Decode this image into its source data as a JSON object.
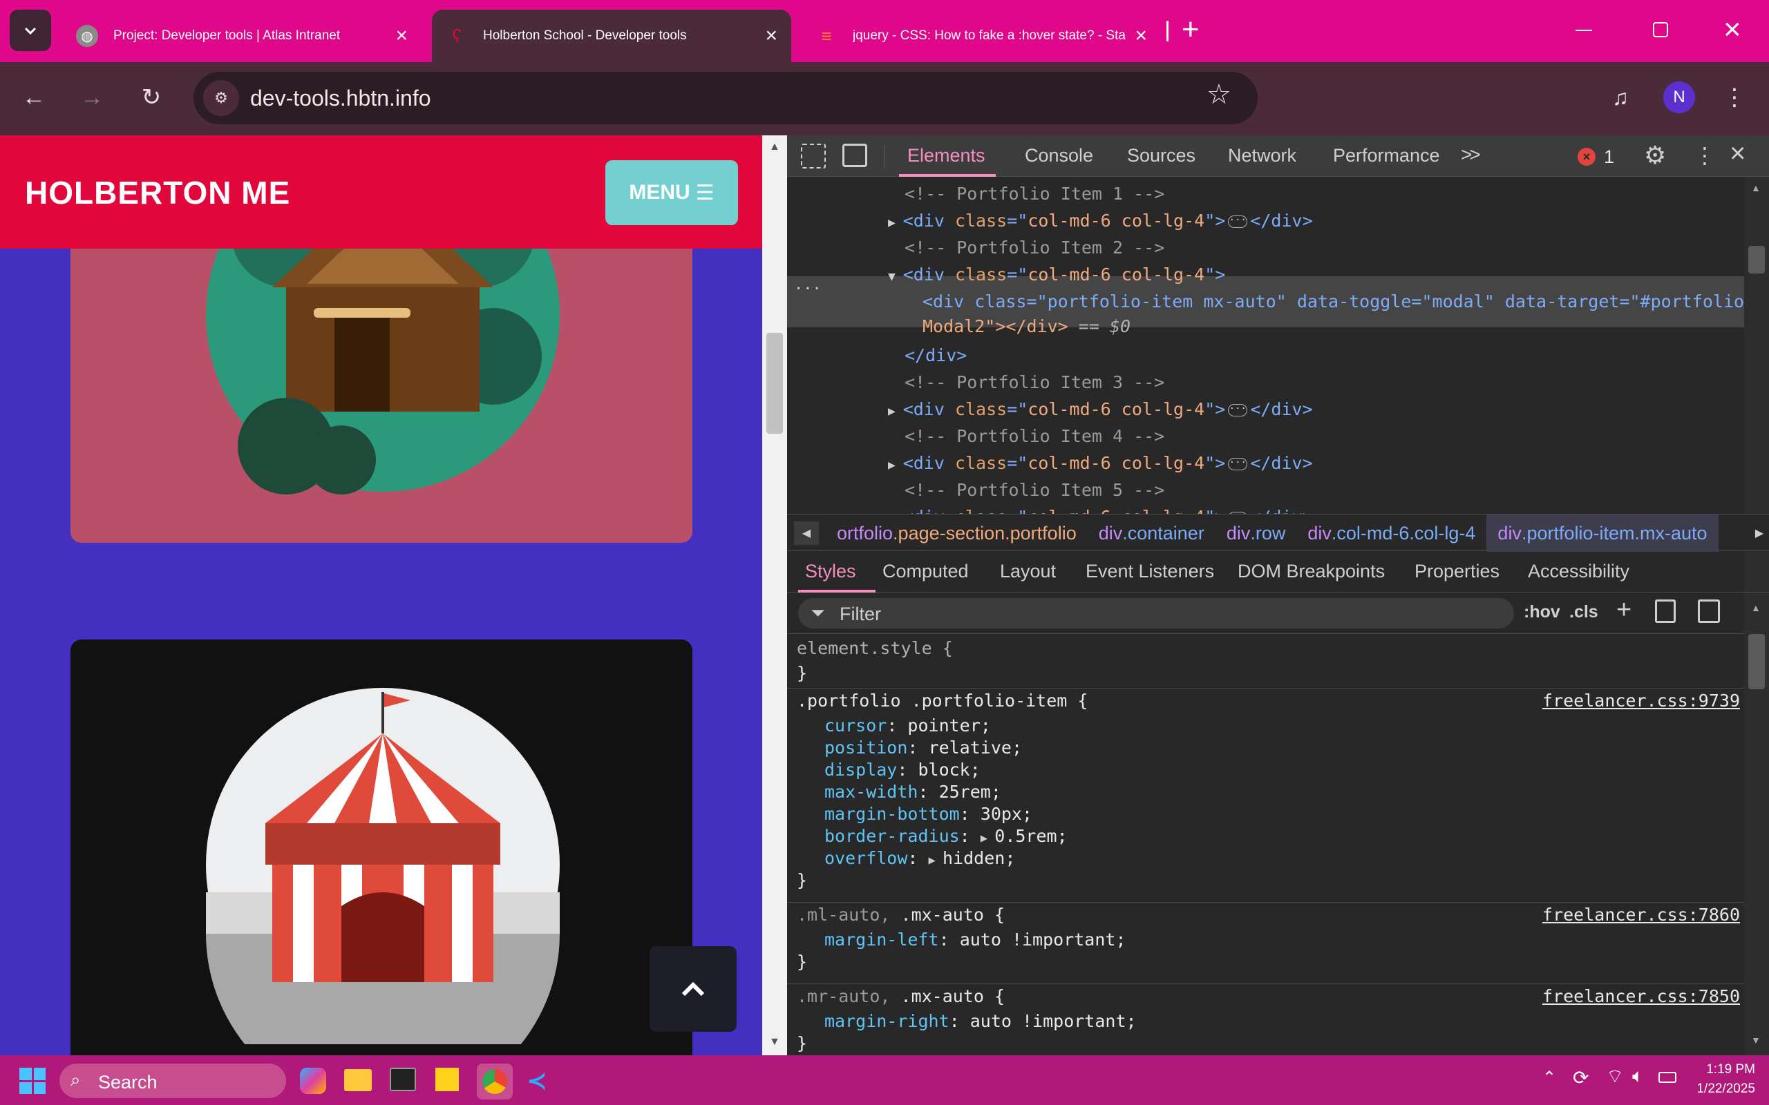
{
  "browser": {
    "tabs": [
      {
        "title": "Project: Developer tools | Atlas Intranet",
        "favicon": "globe-icon"
      },
      {
        "title": "Holberton School - Developer tools",
        "favicon": "seahorse-icon"
      },
      {
        "title": "jquery - CSS: How to fake a :hover state? - Stack",
        "favicon": "stackoverflow-icon"
      }
    ],
    "new_tab": "+",
    "url": "dev-tools.hbtn.info",
    "profile_initial": "N"
  },
  "site": {
    "brand": "HOLBERTON ME",
    "menu_label": "MENU",
    "back_to_top": "^"
  },
  "devtools": {
    "tabs": [
      "Elements",
      "Console",
      "Sources",
      "Network",
      "Performance"
    ],
    "more": ">>",
    "error_count": "1",
    "dom_lines": [
      {
        "type": "comment",
        "text": "<!-- Portfolio Item 1 -->"
      },
      {
        "type": "collapsed",
        "tag": "div",
        "attr": "class",
        "value": "col-md-6 col-lg-4"
      },
      {
        "type": "comment",
        "text": "<!-- Portfolio Item 2 -->"
      },
      {
        "type": "open",
        "tag": "div",
        "attr": "class",
        "value": "col-md-6 col-lg-4"
      },
      {
        "type": "selected",
        "line1": "<div class=\"portfolio-item mx-auto\" data-toggle=\"modal\" data-target=\"#portfolio",
        "line2": "Modal2\"></div>",
        "dollar": "== $0"
      },
      {
        "type": "close",
        "text": "</div>"
      },
      {
        "type": "comment",
        "text": "<!-- Portfolio Item 3 -->"
      },
      {
        "type": "collapsed",
        "tag": "div",
        "attr": "class",
        "value": "col-md-6 col-lg-4"
      },
      {
        "type": "comment",
        "text": "<!-- Portfolio Item 4 -->"
      },
      {
        "type": "collapsed",
        "tag": "div",
        "attr": "class",
        "value": "col-md-6 col-lg-4"
      },
      {
        "type": "comment",
        "text": "<!-- Portfolio Item 5 -->"
      },
      {
        "type": "collapsed",
        "tag": "div",
        "attr": "class",
        "value": "col-md-6 col-lg-4"
      }
    ],
    "breadcrumbs": [
      {
        "text": "ortfolio.page-section.portfolio",
        "prefix": "",
        "tagPart": "ortfolio",
        "classPart": ".page-section.portfolio"
      },
      {
        "text": "div.container",
        "tagPart": "div",
        "classPart": ".container"
      },
      {
        "text": "div.row",
        "tagPart": "div",
        "classPart": ".row"
      },
      {
        "text": "div.col-md-6.col-lg-4",
        "tagPart": "div",
        "classPart": ".col-md-6.col-lg-4"
      },
      {
        "text": "div.portfolio-item.mx-auto",
        "tagPart": "div",
        "classPart": ".portfolio-item.mx-auto"
      }
    ],
    "sub_tabs": [
      "Styles",
      "Computed",
      "Layout",
      "Event Listeners",
      "DOM Breakpoints",
      "Properties",
      "Accessibility"
    ],
    "filter_placeholder": "Filter",
    "hov": ":hov",
    "cls": ".cls",
    "element_style": "element.style {",
    "close_brace": "}",
    "rules": [
      {
        "selector_dim": "",
        "selector": ".portfolio .portfolio-item {",
        "source": "freelancer.css:9739",
        "props": [
          {
            "name": "cursor",
            "value": "pointer;"
          },
          {
            "name": "position",
            "value": "relative;"
          },
          {
            "name": "display",
            "value": "block;"
          },
          {
            "name": "max-width",
            "value": "25rem;"
          },
          {
            "name": "margin-bottom",
            "value": "30px;"
          },
          {
            "name": "border-radius",
            "value": "0.5rem;",
            "expand": true
          },
          {
            "name": "overflow",
            "value": "hidden;",
            "expand": true
          }
        ]
      },
      {
        "selector_dim": ".ml-auto, ",
        "selector": ".mx-auto {",
        "source": "freelancer.css:7860",
        "props": [
          {
            "name": "margin-left",
            "value": "auto !important;"
          }
        ]
      },
      {
        "selector_dim": ".mr-auto, ",
        "selector": ".mx-auto {",
        "source": "freelancer.css:7850",
        "props": [
          {
            "name": "margin-right",
            "value": "auto !important;"
          }
        ]
      }
    ]
  },
  "taskbar": {
    "search_label": "Search",
    "time": "1:19 PM",
    "date": "1/22/2025"
  },
  "colors": {
    "tabstrip": "#e0088a",
    "navbar": "#e2073b",
    "menu_button": "#74cfd0",
    "page_bg": "#4330c0",
    "card1": "#b85068",
    "card2": "#111111"
  }
}
